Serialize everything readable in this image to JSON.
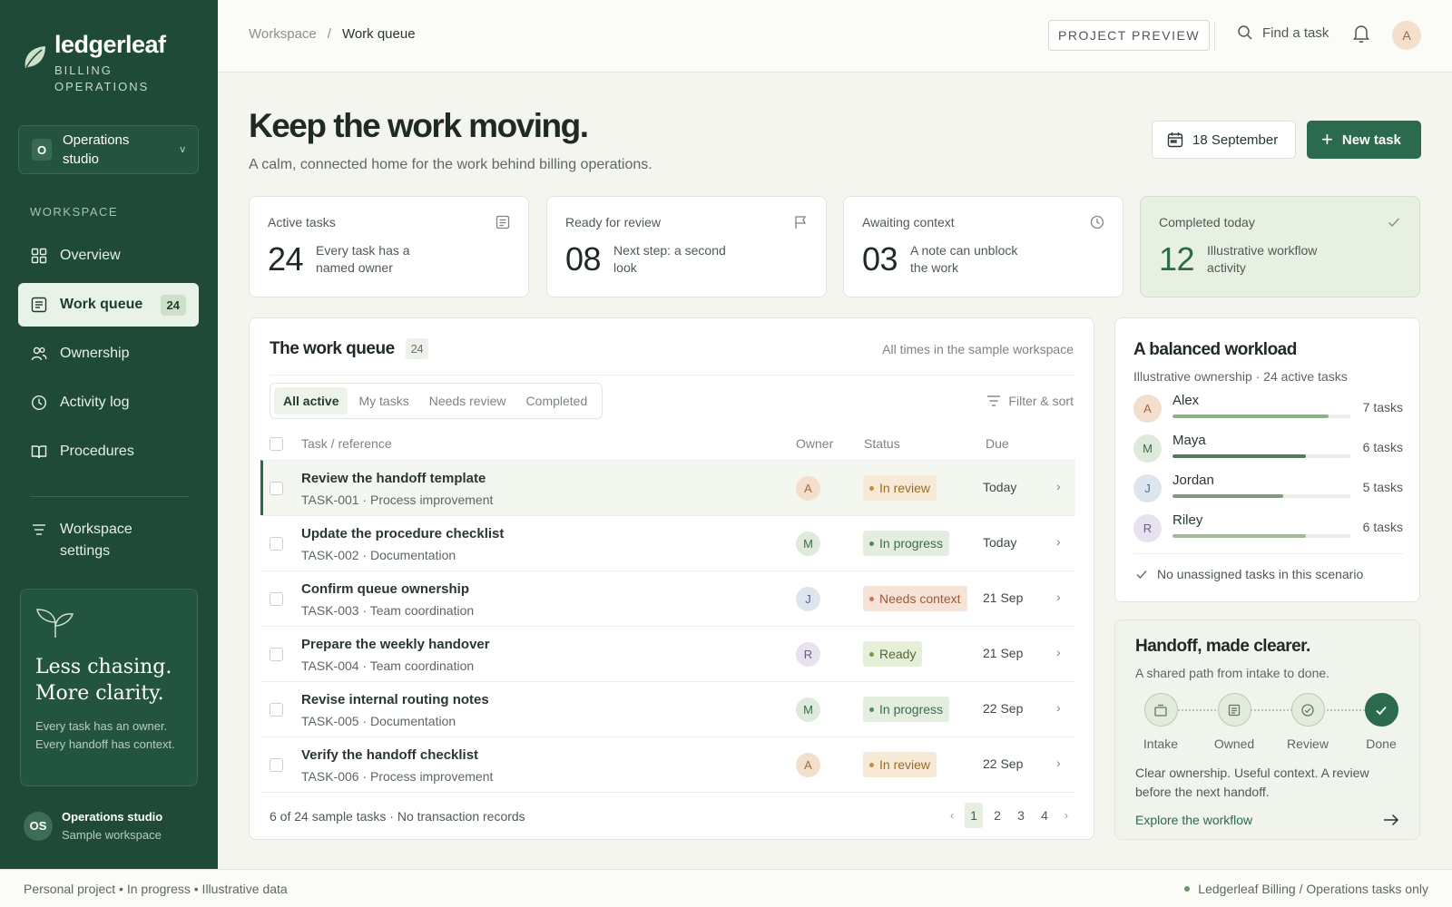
{
  "brand": {
    "name": "ledgerleaf",
    "subtitle": "BILLING OPERATIONS"
  },
  "org": {
    "badge": "O",
    "name": "Operations studio"
  },
  "nav": {
    "section": "WORKSPACE",
    "items": [
      {
        "label": "Overview",
        "icon": "grid-icon"
      },
      {
        "label": "Work queue",
        "icon": "list-icon",
        "count": "24",
        "active": true
      },
      {
        "label": "Ownership",
        "icon": "people-icon"
      },
      {
        "label": "Activity log",
        "icon": "clock-icon"
      },
      {
        "label": "Procedures",
        "icon": "book-icon"
      }
    ],
    "settings": "Workspace settings"
  },
  "promo": {
    "title": "Less chasing. More clarity.",
    "body": "Every task has an owner. Every handoff has context."
  },
  "sidebar_user": {
    "initials": "OS",
    "name": "Operations studio",
    "sub": "Sample workspace"
  },
  "topbar": {
    "breadcrumb": [
      "Workspace",
      "Work queue"
    ],
    "separator": "/",
    "preview": "PROJECT PREVIEW",
    "search_label": "Find a task",
    "avatar": "A"
  },
  "header": {
    "title": "Keep the work moving.",
    "subtitle": "A calm, connected home for the work behind billing operations.",
    "date": "18 September",
    "new_task": "New task"
  },
  "stats": [
    {
      "label": "Active tasks",
      "value": "24",
      "note": "Every task has a named owner",
      "icon": "document-icon"
    },
    {
      "label": "Ready for review",
      "value": "08",
      "note": "Next step: a second look",
      "icon": "flag-icon"
    },
    {
      "label": "Awaiting context",
      "value": "03",
      "note": "A note can unblock the work",
      "icon": "clock-icon"
    },
    {
      "label": "Completed today",
      "value": "12",
      "note": "Illustrative workflow activity",
      "icon": "check-icon"
    }
  ],
  "queue": {
    "title": "The work queue",
    "count": "24",
    "timezone_note": "All times in the sample workspace",
    "tabs": [
      "All active",
      "My tasks",
      "Needs review",
      "Completed"
    ],
    "active_tab": "All active",
    "filter": "Filter & sort",
    "columns": [
      "Task / reference",
      "Owner",
      "Status",
      "Due"
    ],
    "rows": [
      {
        "title": "Review the handoff template",
        "ref": "TASK-001 · Process improvement",
        "owner": "A",
        "status": "In review",
        "due": "Today",
        "selected": true
      },
      {
        "title": "Update the procedure checklist",
        "ref": "TASK-002 · Documentation",
        "owner": "M",
        "status": "In progress",
        "due": "Today"
      },
      {
        "title": "Confirm queue ownership",
        "ref": "TASK-003 · Team coordination",
        "owner": "J",
        "status": "Needs context",
        "due": "21 Sep"
      },
      {
        "title": "Prepare the weekly handover",
        "ref": "TASK-004 · Team coordination",
        "owner": "R",
        "status": "Ready",
        "due": "21 Sep"
      },
      {
        "title": "Revise internal routing notes",
        "ref": "TASK-005 · Documentation",
        "owner": "M",
        "status": "In progress",
        "due": "22 Sep"
      },
      {
        "title": "Verify the handoff checklist",
        "ref": "TASK-006 · Process improvement",
        "owner": "A",
        "status": "In review",
        "due": "22 Sep"
      }
    ],
    "footer": "6 of 24 sample tasks · No transaction records",
    "pages": [
      "1",
      "2",
      "3",
      "4"
    ],
    "current_page": "1",
    "prev": "‹",
    "next": "›"
  },
  "workload": {
    "title": "A balanced workload",
    "subtitle": "Illustrative ownership · 24 active tasks",
    "people": [
      {
        "initial": "A",
        "name": "Alex",
        "tasks": "7 tasks",
        "share": 0.88
      },
      {
        "initial": "M",
        "name": "Maya",
        "tasks": "6 tasks",
        "share": 0.75
      },
      {
        "initial": "J",
        "name": "Jordan",
        "tasks": "5 tasks",
        "share": 0.62
      },
      {
        "initial": "R",
        "name": "Riley",
        "tasks": "6 tasks",
        "share": 0.75
      }
    ],
    "note": "No unassigned tasks in this scenario"
  },
  "handoff": {
    "title": "Handoff, made clearer.",
    "subtitle": "A shared path from intake to done.",
    "steps": [
      "Intake",
      "Owned",
      "Review",
      "Done"
    ],
    "text": "Clear ownership. Useful context. A review before the next handoff.",
    "link": "Explore the workflow"
  },
  "footer": {
    "left": "Personal project • In progress • Illustrative data",
    "right": "Ledgerleaf Billing / Operations tasks only"
  },
  "colors": {
    "sidebar": "#1e4a37",
    "accent": "#2b6a4c",
    "owner_A": "#f3dfcc",
    "owner_M": "#dfe9dc",
    "owner_J": "#dde5ef",
    "owner_R": "#e8e2ef",
    "status_review": "#f6ead7",
    "status_progress": "#e4eedf",
    "status_context": "#f6e2d6",
    "status_ready": "#e6efd9"
  }
}
